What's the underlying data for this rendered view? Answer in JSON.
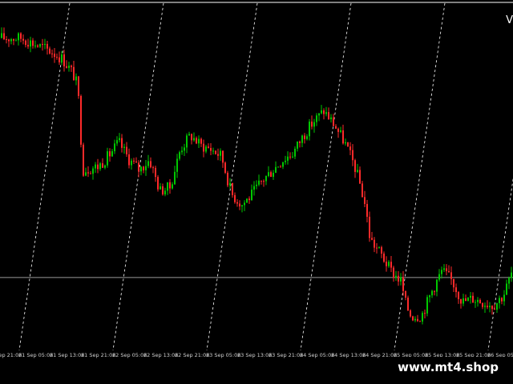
{
  "colors": {
    "background": "#000000",
    "bull_candle": "#00c800",
    "bear_candle": "#ff2a2a",
    "grid": "#ffffff",
    "horizontal_line": "#9a9a9a",
    "axis_text": "#cfcfcf"
  },
  "watermark": "www.mt4.shop",
  "corner_label": "V",
  "chart_data": {
    "type": "candlestick",
    "time_axis": {
      "tick_labels": [
        "20 Sep 21:06",
        "21 Sep 05:06",
        "21 Sep 13:06",
        "21 Sep 21:06",
        "22 Sep 05:06",
        "22 Sep 13:06",
        "22 Sep 21:06",
        "23 Sep 05:06",
        "23 Sep 13:06",
        "23 Sep 21:06",
        "24 Sep 05:06",
        "24 Sep 13:06",
        "24 Sep 21:06",
        "25 Sep 05:06",
        "25 Sep 13:06",
        "25 Sep 21:06",
        "26 Sep 05:06",
        "26 Sep 13:06",
        "26"
      ],
      "vertical_grid_dashed": true,
      "grid_at_label_index": [
        1,
        4,
        7,
        10,
        13,
        16
      ]
    },
    "horizontal_level_fraction": 0.21,
    "close_path_fraction": [
      [
        0.0,
        0.9
      ],
      [
        0.04,
        0.9
      ],
      [
        0.07,
        0.88
      ],
      [
        0.1,
        0.86
      ],
      [
        0.12,
        0.84
      ],
      [
        0.14,
        0.8
      ],
      [
        0.15,
        0.76
      ],
      [
        0.16,
        0.52
      ],
      [
        0.19,
        0.53
      ],
      [
        0.21,
        0.56
      ],
      [
        0.23,
        0.6
      ],
      [
        0.25,
        0.55
      ],
      [
        0.27,
        0.52
      ],
      [
        0.29,
        0.55
      ],
      [
        0.31,
        0.46
      ],
      [
        0.33,
        0.47
      ],
      [
        0.35,
        0.58
      ],
      [
        0.37,
        0.62
      ],
      [
        0.39,
        0.59
      ],
      [
        0.41,
        0.58
      ],
      [
        0.43,
        0.56
      ],
      [
        0.45,
        0.45
      ],
      [
        0.47,
        0.42
      ],
      [
        0.49,
        0.45
      ],
      [
        0.51,
        0.49
      ],
      [
        0.53,
        0.52
      ],
      [
        0.55,
        0.55
      ],
      [
        0.57,
        0.57
      ],
      [
        0.59,
        0.62
      ],
      [
        0.61,
        0.66
      ],
      [
        0.63,
        0.69
      ],
      [
        0.65,
        0.65
      ],
      [
        0.67,
        0.6
      ],
      [
        0.69,
        0.53
      ],
      [
        0.7,
        0.48
      ],
      [
        0.71,
        0.42
      ],
      [
        0.72,
        0.32
      ],
      [
        0.74,
        0.28
      ],
      [
        0.76,
        0.23
      ],
      [
        0.78,
        0.2
      ],
      [
        0.79,
        0.13
      ],
      [
        0.8,
        0.1
      ],
      [
        0.82,
        0.1
      ],
      [
        0.84,
        0.17
      ],
      [
        0.86,
        0.23
      ],
      [
        0.88,
        0.2
      ],
      [
        0.9,
        0.14
      ],
      [
        0.92,
        0.15
      ],
      [
        0.94,
        0.14
      ],
      [
        0.96,
        0.13
      ],
      [
        0.98,
        0.16
      ],
      [
        1.0,
        0.24
      ]
    ]
  }
}
